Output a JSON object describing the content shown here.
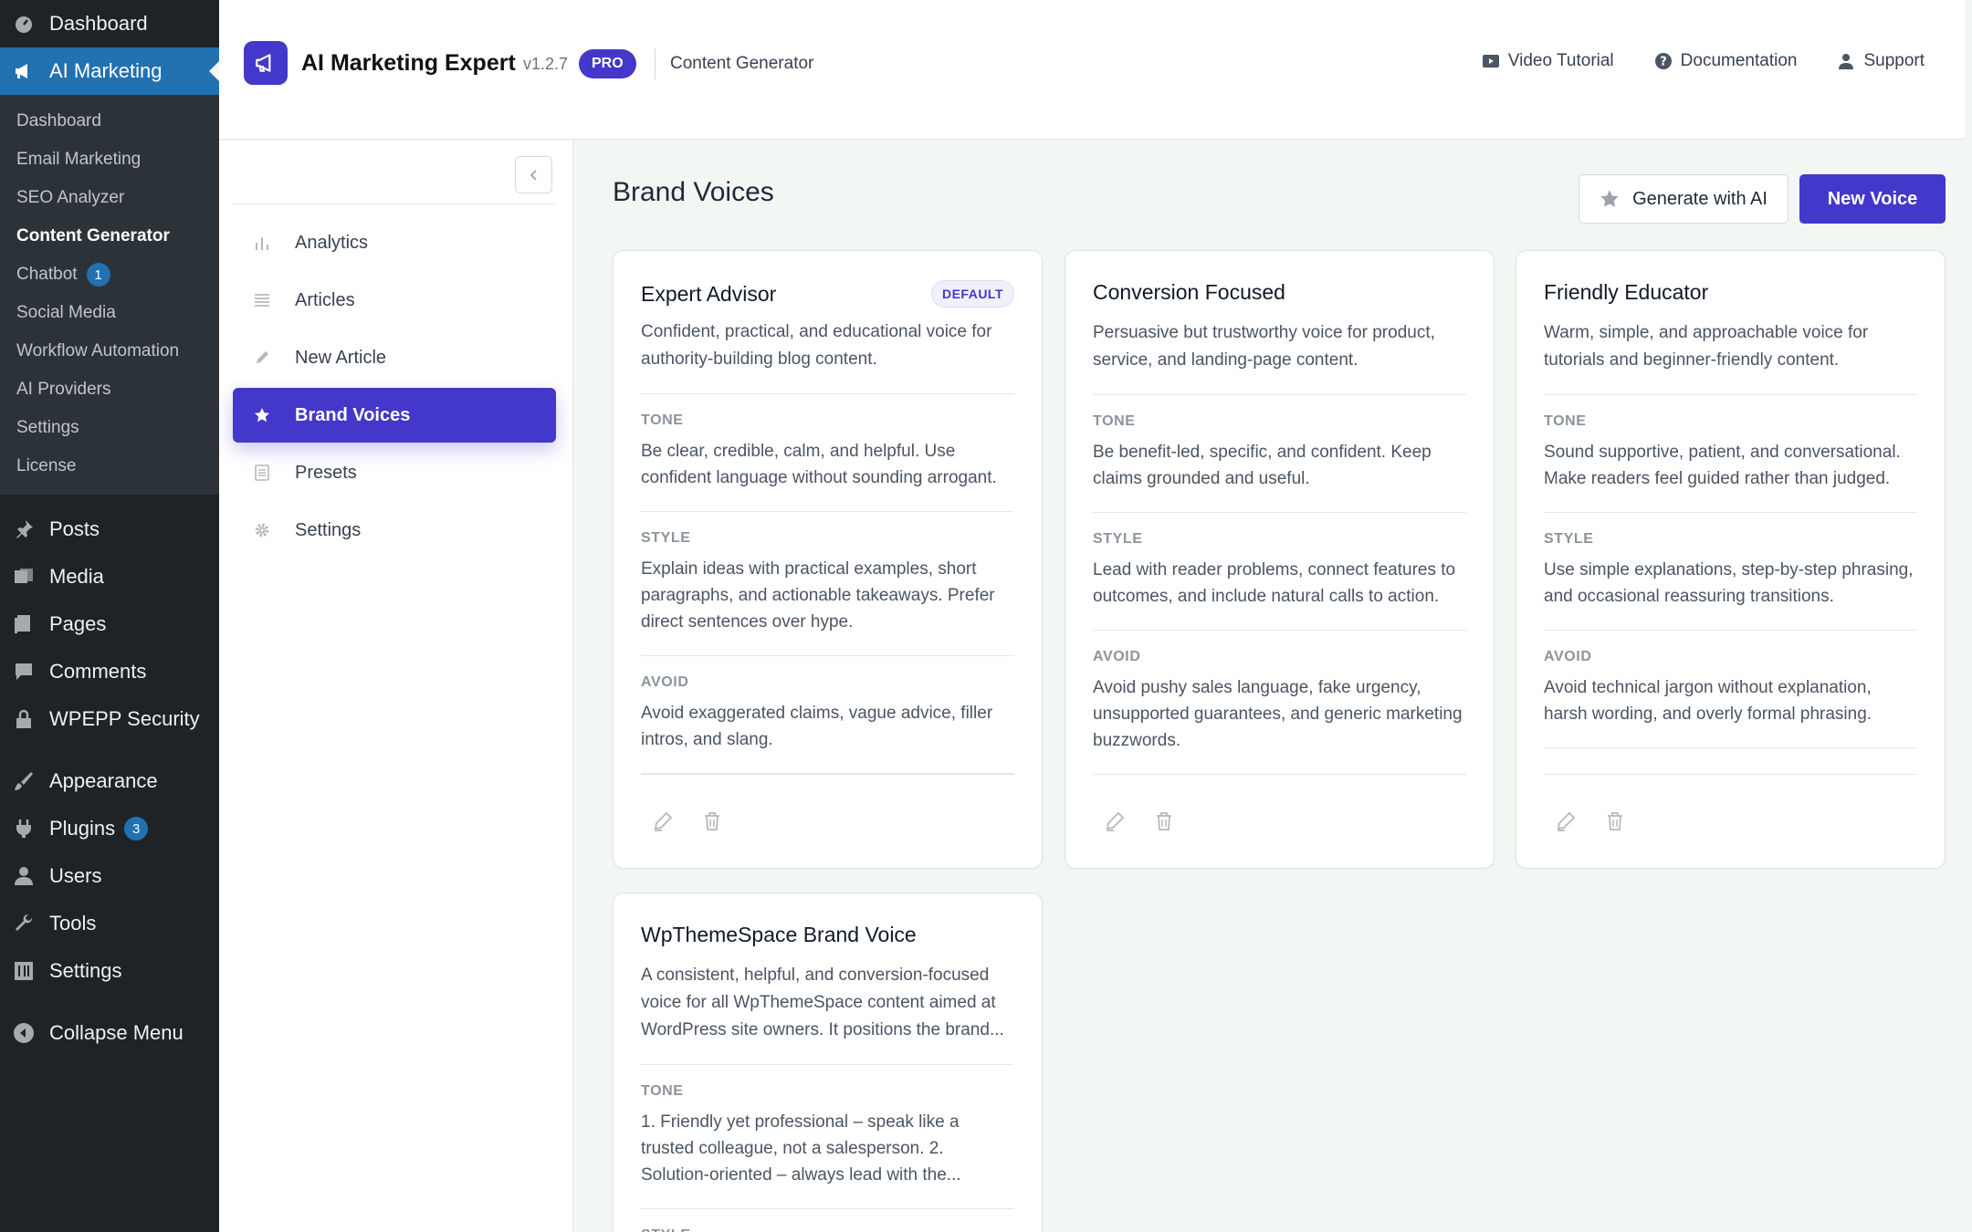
{
  "wp_menu": {
    "dashboard": "Dashboard",
    "ai_marketing": "AI Marketing",
    "submenu": [
      {
        "label": "Dashboard"
      },
      {
        "label": "Email Marketing"
      },
      {
        "label": "SEO Analyzer"
      },
      {
        "label": "Content Generator"
      },
      {
        "label": "Chatbot",
        "badge": "1"
      },
      {
        "label": "Social Media"
      },
      {
        "label": "Workflow Automation"
      },
      {
        "label": "AI Providers"
      },
      {
        "label": "Settings"
      },
      {
        "label": "License"
      }
    ],
    "posts": "Posts",
    "media": "Media",
    "pages": "Pages",
    "comments": "Comments",
    "security": "WPEPP Security",
    "appearance": "Appearance",
    "plugins": "Plugins",
    "plugins_badge": "3",
    "users": "Users",
    "tools": "Tools",
    "settings": "Settings",
    "collapse": "Collapse Menu"
  },
  "header": {
    "title": "AI Marketing Expert",
    "version": "v1.2.7",
    "pro": "PRO",
    "section": "Content Generator",
    "links": {
      "video": "Video Tutorial",
      "docs": "Documentation",
      "support": "Support"
    }
  },
  "nav": {
    "analytics": "Analytics",
    "articles": "Articles",
    "new_article": "New Article",
    "brand_voices": "Brand Voices",
    "presets": "Presets",
    "settings": "Settings"
  },
  "main": {
    "title": "Brand Voices",
    "generate_label": "Generate with AI",
    "new_label": "New Voice"
  },
  "labels": {
    "tone": "TONE",
    "style": "STYLE",
    "avoid": "AVOID",
    "default": "DEFAULT"
  },
  "cards": [
    {
      "name": "Expert Advisor",
      "desc": "Confident, practical, and educational voice for authority-building blog content.",
      "tone": "Be clear, credible, calm, and helpful. Use confident language without sounding arrogant.",
      "style": "Explain ideas with practical examples, short paragraphs, and actionable takeaways. Prefer direct sentences over hype.",
      "avoid": "Avoid exaggerated claims, vague advice, filler intros, and slang."
    },
    {
      "name": "Conversion Focused",
      "desc": "Persuasive but trustworthy voice for product, service, and landing-page content.",
      "tone": "Be benefit-led, specific, and confident. Keep claims grounded and useful.",
      "style": "Lead with reader problems, connect features to outcomes, and include natural calls to action.",
      "avoid": "Avoid pushy sales language, fake urgency, unsupported guarantees, and generic marketing buzzwords."
    },
    {
      "name": "Friendly Educator",
      "desc": "Warm, simple, and approachable voice for tutorials and beginner-friendly content.",
      "tone": "Sound supportive, patient, and conversational. Make readers feel guided rather than judged.",
      "style": "Use simple explanations, step-by-step phrasing, and occasional reassuring transitions.",
      "avoid": "Avoid technical jargon without explanation, harsh wording, and overly formal phrasing."
    },
    {
      "name": "WpThemeSpace Brand Voice",
      "desc": "A consistent, helpful, and conversion-focused voice for all WpThemeSpace content aimed at WordPress site owners. It positions the brand...",
      "tone": "1. Friendly yet professional – speak like a trusted colleague, not a salesperson. 2. Solution-oriented – always lead with the..."
    }
  ]
}
